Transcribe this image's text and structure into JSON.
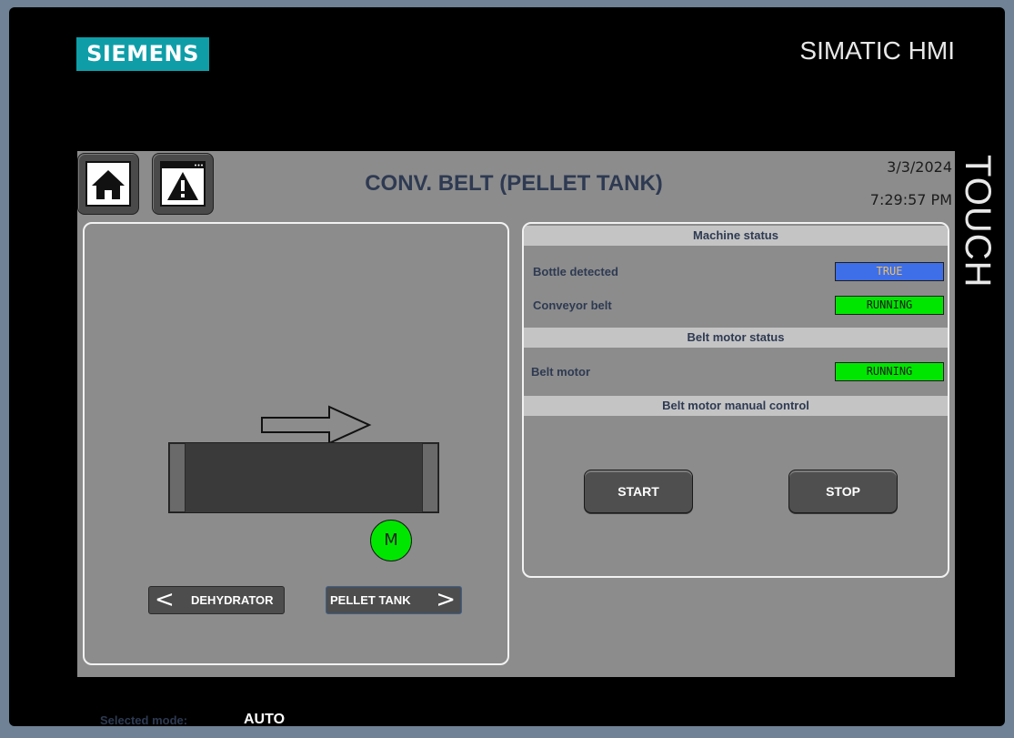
{
  "brand": {
    "logo": "SIEMENS",
    "title": "SIMATIC HMI",
    "side_label": "TOUCH"
  },
  "header": {
    "title": "CONV. BELT (PELLET TANK)",
    "date": "3/3/2024",
    "time": "7:29:57 PM"
  },
  "toolbar": {
    "home_icon": "home-icon",
    "alarm_icon": "alarm-warning-icon"
  },
  "left_panel": {
    "motor_label": "M",
    "nav": {
      "prev_label": "DEHYDRATOR",
      "next_label": "PELLET TANK"
    },
    "mode_label": "Selected mode:",
    "mode_value": "AUTO"
  },
  "right_panel": {
    "machine_status_header": "Machine status",
    "bottle_label": "Bottle detected",
    "bottle_value": "TRUE",
    "conveyor_label": "Conveyor belt",
    "conveyor_value": "RUNNING",
    "motor_status_header": "Belt motor status",
    "belt_motor_label": "Belt motor",
    "belt_motor_value": "RUNNING",
    "manual_header": "Belt motor manual control",
    "start_label": "START",
    "stop_label": "STOP"
  },
  "colors": {
    "true_bg": "#3f6fe8",
    "true_fg": "#f0c060",
    "running_bg": "#00e600",
    "running_fg": "#1a1a1a",
    "motor_on": "#00e600"
  }
}
